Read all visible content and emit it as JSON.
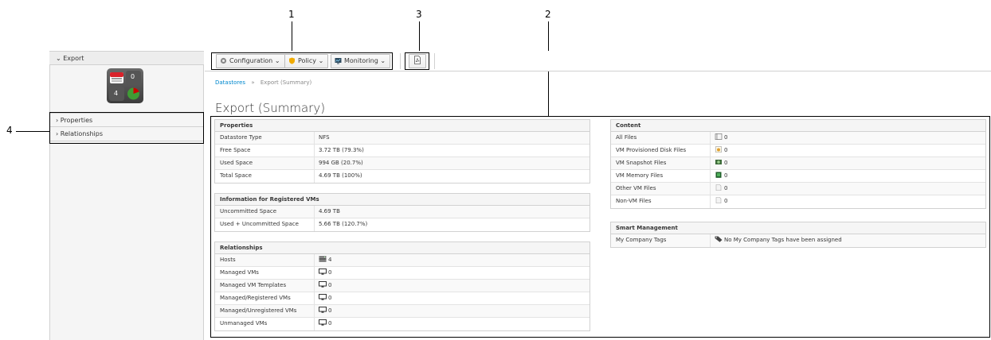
{
  "callouts": [
    "1",
    "2",
    "3",
    "4"
  ],
  "sidebar": {
    "header": "Export",
    "quadicon": {
      "top_right": "0",
      "bottom_left": "4"
    },
    "accordion": [
      "Properties",
      "Relationships"
    ]
  },
  "toolbar": {
    "configuration": "Configuration",
    "policy": "Policy",
    "monitoring": "Monitoring"
  },
  "breadcrumb": {
    "parent": "Datastores",
    "separator": "»",
    "current": "Export (Summary)"
  },
  "page_title": "Export (Summary)",
  "properties": {
    "title": "Properties",
    "rows": [
      {
        "label": "Datastore Type",
        "value": "NFS"
      },
      {
        "label": "Free Space",
        "value": "3.72 TB (79.3%)"
      },
      {
        "label": "Used Space",
        "value": "994 GB (20.7%)"
      },
      {
        "label": "Total Space",
        "value": "4.69 TB (100%)"
      }
    ]
  },
  "registered_vms": {
    "title": "Information for Registered VMs",
    "rows": [
      {
        "label": "Uncommitted Space",
        "value": "4.69 TB"
      },
      {
        "label": "Used + Uncommitted Space",
        "value": "5.66 TB (120.7%)"
      }
    ]
  },
  "relationships": {
    "title": "Relationships",
    "rows": [
      {
        "label": "Hosts",
        "value": "4",
        "icon": "host-icon"
      },
      {
        "label": "Managed VMs",
        "value": "0",
        "icon": "monitor-icon"
      },
      {
        "label": "Managed VM Templates",
        "value": "0",
        "icon": "monitor-icon"
      },
      {
        "label": "Managed/Registered VMs",
        "value": "0",
        "icon": "monitor-icon"
      },
      {
        "label": "Managed/Unregistered VMs",
        "value": "0",
        "icon": "monitor-icon"
      },
      {
        "label": "Unmanaged VMs",
        "value": "0",
        "icon": "monitor-icon"
      }
    ]
  },
  "content": {
    "title": "Content",
    "rows": [
      {
        "label": "All Files",
        "value": "0",
        "icon": "files-icon"
      },
      {
        "label": "VM Provisioned Disk Files",
        "value": "0",
        "icon": "disk-file-icon"
      },
      {
        "label": "VM Snapshot Files",
        "value": "0",
        "icon": "snapshot-file-icon"
      },
      {
        "label": "VM Memory Files",
        "value": "0",
        "icon": "memory-file-icon"
      },
      {
        "label": "Other VM Files",
        "value": "0",
        "icon": "file-icon"
      },
      {
        "label": "Non-VM Files",
        "value": "0",
        "icon": "file-icon"
      }
    ]
  },
  "smart_management": {
    "title": "Smart Management",
    "rows": [
      {
        "label": "My Company Tags",
        "value": "No My Company Tags have been assigned",
        "icon": "tag-icon"
      }
    ]
  },
  "colors": {
    "link": "#0088ce",
    "border": "#d1d1d1",
    "header_bg": "#f5f5f5"
  }
}
